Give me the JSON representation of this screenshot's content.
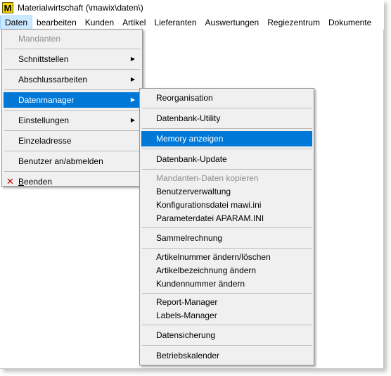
{
  "window": {
    "title": "Materialwirtschaft (\\mawix\\daten\\)",
    "icon_letter": "M"
  },
  "menubar": [
    {
      "label": "Daten",
      "active": true
    },
    {
      "label": "bearbeiten"
    },
    {
      "label": "Kunden"
    },
    {
      "label": "Artikel"
    },
    {
      "label": "Lieferanten"
    },
    {
      "label": "Auswertungen"
    },
    {
      "label": "Regiezentrum"
    },
    {
      "label": "Dokumente"
    }
  ],
  "daten_menu": {
    "mandanten": "Mandanten",
    "schnittstellen": "Schnittstellen",
    "abschlussarbeiten": "Abschlussarbeiten",
    "datenmanager": "Datenmanager",
    "einstellungen": "Einstellungen",
    "einzeladresse": "Einzeladresse",
    "benutzer": "Benutzer an/abmelden",
    "beenden_first": "B",
    "beenden_rest": "eenden"
  },
  "datenmanager_menu": {
    "reorganisation": "Reorganisation",
    "datenbank_utility": "Datenbank-Utility",
    "memory_anzeigen": "Memory anzeigen",
    "datenbank_update": "Datenbank-Update",
    "mandanten_daten_kopieren": "Mandanten-Daten kopieren",
    "benutzerverwaltung": "Benutzerverwaltung",
    "konfigurationsdatei": "Konfigurationsdatei mawi.ini",
    "parameterdatei": "Parameterdatei APARAM.INI",
    "sammelrechnung": "Sammelrechnung",
    "artikelnummer_aendern": "Artikelnummer ändern/löschen",
    "artikelbezeichnung_aendern": "Artikelbezeichnung ändern",
    "kundennummer_aendern": "Kundennummer ändern",
    "report_manager": "Report-Manager",
    "labels_manager": "Labels-Manager",
    "datensicherung": "Datensicherung",
    "betriebskalender": "Betriebskalender"
  },
  "colors": {
    "menu_bg": "#f0f0f0",
    "highlight": "#0078d7",
    "menubar_active": "#cce8ff",
    "disabled_text": "#8d8d8d",
    "exit_icon": "#c00000"
  },
  "icons": {
    "submenu_arrow": "triangle-right-icon",
    "exit": "x-icon"
  }
}
